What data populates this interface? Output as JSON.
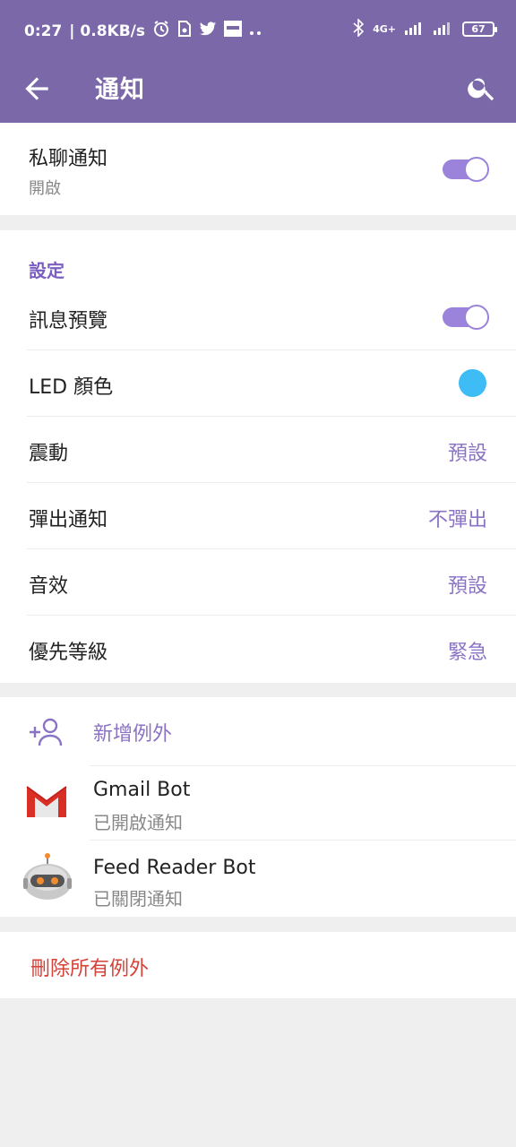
{
  "statusbar": {
    "time": "0:27",
    "speed": "| 0.8KB/s",
    "network": "4G+",
    "battery": "67",
    "icons": [
      "alarm-icon",
      "sim-icon",
      "twitter-icon",
      "app-icon",
      "more-dots-icon",
      "bluetooth-icon",
      "signal-icon",
      "signal-icon-2",
      "battery-icon"
    ]
  },
  "toolbar": {
    "title": "通知",
    "back_icon": "arrow-left-icon",
    "search_icon": "search-icon"
  },
  "private": {
    "label": "私聊通知",
    "status": "開啟",
    "enabled": true
  },
  "settings": {
    "title": "設定",
    "preview_label": "訊息預覽",
    "preview_enabled": true,
    "led_label": "LED 顏色",
    "led_color": "#3dbcf5",
    "vibrate_label": "震動",
    "vibrate_value": "預設",
    "popup_label": "彈出通知",
    "popup_value": "不彈出",
    "sound_label": "音效",
    "sound_value": "預設",
    "priority_label": "優先等級",
    "priority_value": "緊急"
  },
  "exceptions": {
    "add_label": "新增例外",
    "items": [
      {
        "name": "Gmail Bot",
        "status": "已開啟通知",
        "icon": "gmail-icon"
      },
      {
        "name": "Feed Reader Bot",
        "status": "已關閉通知",
        "icon": "robot-avatar-icon"
      }
    ]
  },
  "delete_all_label": "刪除所有例外",
  "colors": {
    "accent": "#7b68a8",
    "value": "#8a73c4",
    "danger": "#d44238"
  }
}
